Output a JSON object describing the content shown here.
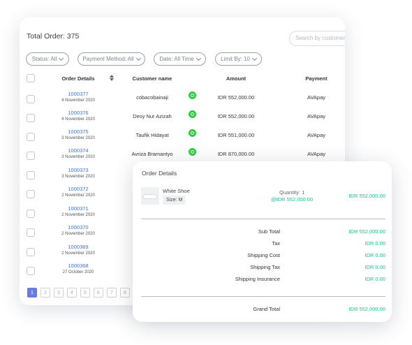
{
  "orders": {
    "title": "Total Order: 375",
    "search_placeholder": "Search by customer n",
    "filters": [
      "Status: All",
      "Payment Method: All",
      "Date: All Time",
      "Limit By: 10"
    ],
    "columns": [
      "Order Details",
      "Customer name",
      "Amount",
      "Payment"
    ],
    "rows": [
      {
        "id": "1000377",
        "date": "4 November 2020",
        "customer": "cobacobainaji",
        "amount": "IDR 552,000.00",
        "payment": "AVApay"
      },
      {
        "id": "1000376",
        "date": "4 November 2020",
        "customer": "Desy Nur Azizah",
        "amount": "IDR 552,000.00",
        "payment": "AVApay"
      },
      {
        "id": "1000375",
        "date": "3 November 2020",
        "customer": "Taufik Hidayat",
        "amount": "IDR 551,000.00",
        "payment": "AVApay"
      },
      {
        "id": "1000374",
        "date": "3 November 2020",
        "customer": "Avriza Bramantyo",
        "amount": "IDR 870,000.00",
        "payment": "AVApay"
      },
      {
        "id": "1000373",
        "date": "3 November 2020"
      },
      {
        "id": "1000372",
        "date": "2 November 2020"
      },
      {
        "id": "1000371",
        "date": "2 November 2020"
      },
      {
        "id": "1000370",
        "date": "2 November 2020"
      },
      {
        "id": "1000369",
        "date": "2 November 2020"
      },
      {
        "id": "1000368",
        "date": "27 October 2020"
      }
    ],
    "pages": [
      "1",
      "2",
      "3",
      "4",
      "5",
      "6",
      "7",
      "8"
    ],
    "active_page": "1"
  },
  "details": {
    "title": "Order Details",
    "product_name": "White Shoe",
    "size": "Size: M",
    "quantity": "Quantity: 1",
    "unit_price": "@IDR 552,000.00",
    "line_total": "IDR 552,000.00",
    "summary": [
      {
        "label": "Sub Total",
        "value": "IDR 552,000.00"
      },
      {
        "label": "Tax",
        "value": "IDR 0.00"
      },
      {
        "label": "Shipping Cost",
        "value": "IDR 0.00"
      },
      {
        "label": "Shipping Tax",
        "value": "IDR 0.00"
      },
      {
        "label": "Shipping Insurance",
        "value": "IDR 0.00"
      }
    ],
    "grand_total_label": "Grand Total",
    "grand_total_value": "IDR 552,000.00"
  },
  "colors": {
    "link": "#3a72d8",
    "accent_green": "#1fbf8f",
    "whatsapp": "#2ecc40",
    "active_page": "#6a7be0"
  },
  "icons": {
    "row_contact": "whatsapp-icon",
    "sort": "sort-icon",
    "filter": "chevron-down-icon"
  }
}
